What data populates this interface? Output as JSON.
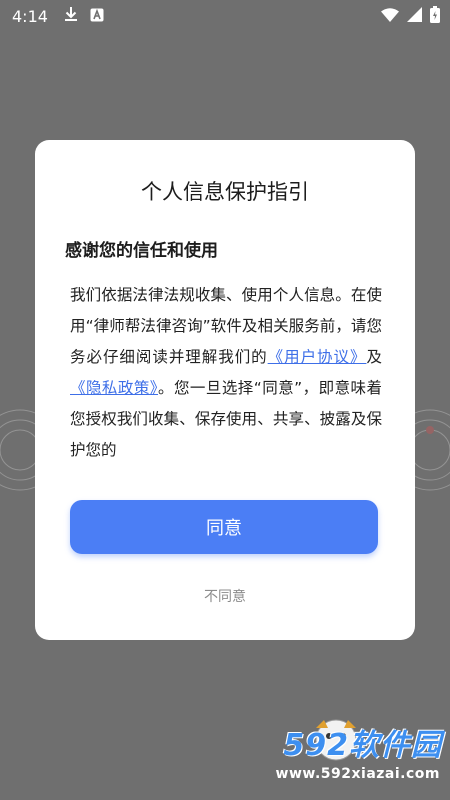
{
  "status_bar": {
    "time": "4:14",
    "left_icons": [
      "download-icon",
      "keyboard-icon"
    ],
    "right_icons": [
      "wifi-icon",
      "signal-icon",
      "battery-icon"
    ]
  },
  "dialog": {
    "title": "个人信息保护指引",
    "subtitle": "感谢您的信任和使用",
    "body_part1": "我们依据法律法规收集、使用个人信息。在使用“律师帮法律咨询”软件及相关服务前，请您务必仔细阅读并理解我们的",
    "user_agreement_link": "《用户协议》",
    "conjunction": "及",
    "privacy_policy_link": "《隐私政策》",
    "body_part2": "。您一旦选择“同意”，即意味着您授权我们收集、保存使用、共享、披露及保护您的",
    "agree_label": "同意",
    "disagree_label": "不同意"
  },
  "watermark": {
    "brand": "592软件园",
    "url": "www.592xiazai.com"
  },
  "colors": {
    "backdrop": "#6f6f6f",
    "primary": "#4b7ef5",
    "link": "#3e6fe8",
    "watermark_brand": "#3d8ff0"
  }
}
